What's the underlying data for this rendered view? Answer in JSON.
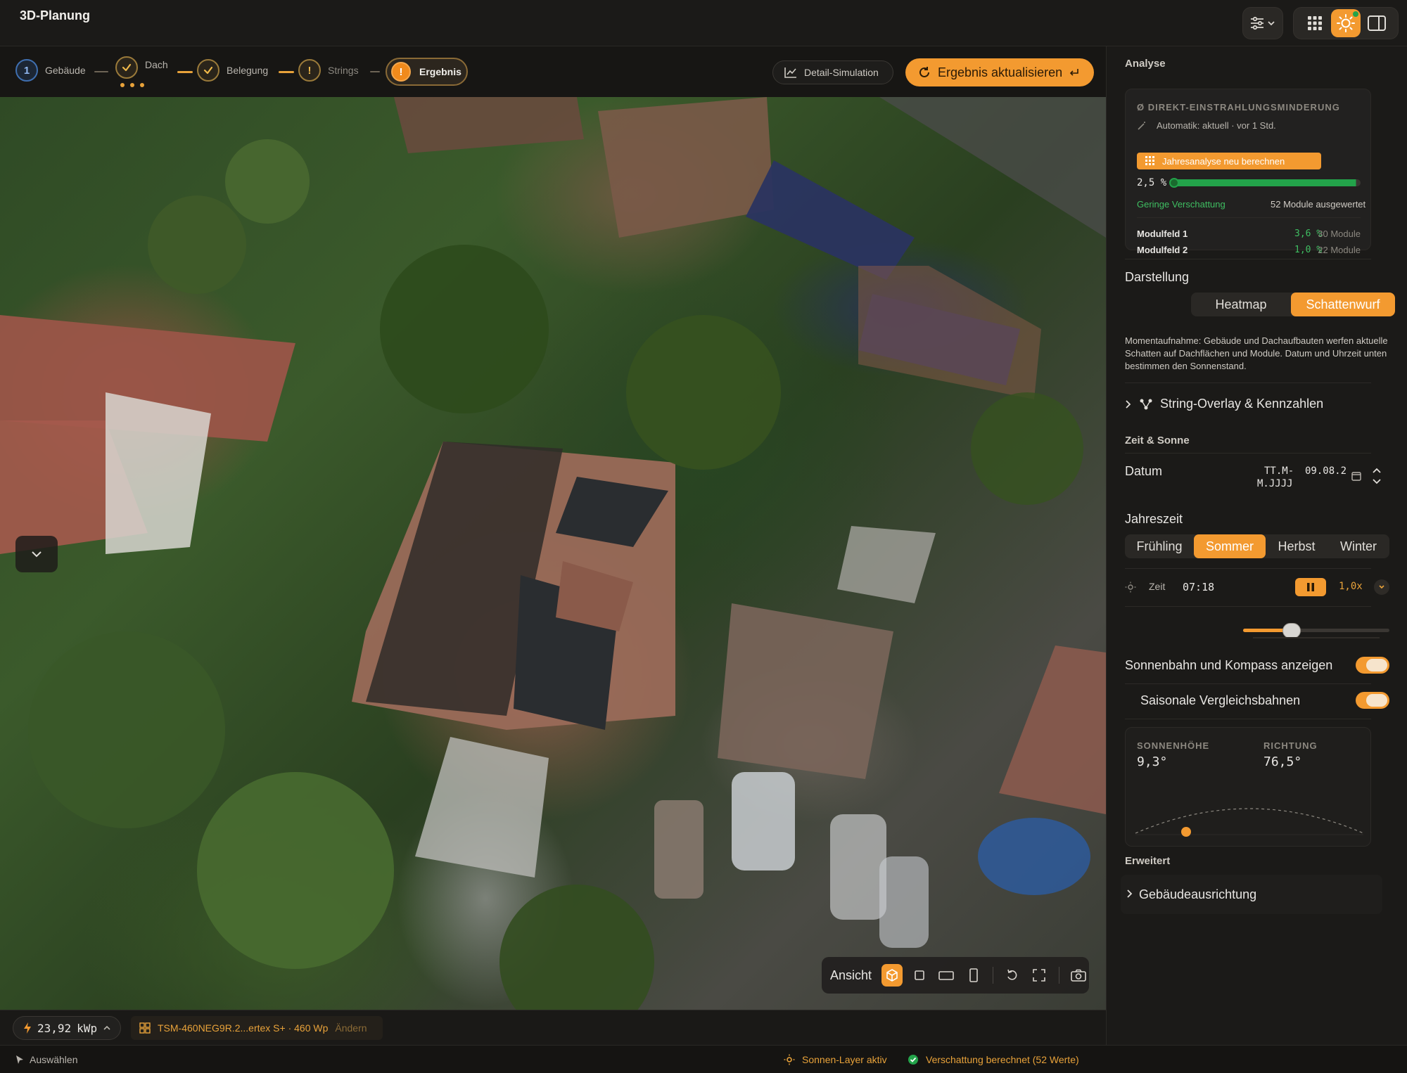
{
  "app": {
    "title": "3D-Planung"
  },
  "steps": [
    {
      "label": "Gebäude",
      "number": "1",
      "status": "done-number"
    },
    {
      "label": "Dach",
      "status": "check"
    },
    {
      "label": "Belegung",
      "status": "check"
    },
    {
      "label": "Strings",
      "status": "warning"
    },
    {
      "label": "Ergebnis",
      "status": "active-warning"
    }
  ],
  "step_icons": {
    "warning": "!",
    "check": "check-icon"
  },
  "actions": {
    "detail_sim": "Detail-Simulation",
    "update": "Ergebnis aktualisieren"
  },
  "view_toolbar": {
    "label": "Ansicht"
  },
  "bottom": {
    "kwp_value": "23,92",
    "kwp_unit": "kWp",
    "module_text": "TSM-460NEG9R.2...ertex S+ · 460 Wp",
    "module_change": "Ändern"
  },
  "status": {
    "select_tool": "Auswählen",
    "sun_layer": "Sonnen-Layer aktiv",
    "shade_calc": "Verschattung berechnet (52 Werte)"
  },
  "panel": {
    "analyse_title": "Analyse",
    "card": {
      "heading": "Ø DIREKT-EINSTRAHLUNGSMINDERUNG",
      "auto": "Automatik: aktuell · vor 1 Std.",
      "recalc": "Jahresanalyse neu berechnen",
      "value": "2,5 %",
      "progress_fraction": 0.975,
      "shading_label": "Geringe Verschattung",
      "modules_evaluated": "52 Module ausgewertet",
      "fields": [
        {
          "name": "Modulfeld 1",
          "pct": "3,6 %",
          "modules": "30 Module"
        },
        {
          "name": "Modulfeld 2",
          "pct": "1,0 %",
          "modules": "22 Module"
        }
      ]
    },
    "darstellung_title": "Darstellung",
    "darstellung_options": [
      "Heatmap",
      "Schattenwurf"
    ],
    "darstellung_selected": "Schattenwurf",
    "darstellung_desc": "Momentaufnahme: Gebäude und Dachaufbauten werfen aktuelle Schatten auf Dachflächen und Module. Datum und Uhrzeit unten bestimmen den Sonnenstand.",
    "string_overlay": "String-Overlay & Kennzahlen",
    "zeit_sonne_title": "Zeit & Sonne",
    "datum_label": "Datum",
    "datum_placeholder_1": "TT.M-",
    "datum_placeholder_2": "M.JJJJ",
    "datum_value": "09.08.2",
    "jahreszeit_label": "Jahreszeit",
    "seasons": [
      "Frühling",
      "Sommer",
      "Herbst",
      "Winter"
    ],
    "season_selected": "Sommer",
    "zeit_label": "Zeit",
    "zeit_value": "07:18",
    "speed": "1,0x",
    "time_slider_fraction": 0.33,
    "sunpath_label": "Sonnenbahn und Kompass anzeigen",
    "sunpath_on": true,
    "seasonal_label": "Saisonale Vergleichsbahnen",
    "seasonal_on": true,
    "sonnenhoehe_label": "SONNENHÖHE",
    "sonnenhoehe_value": "9,3°",
    "richtung_label": "RICHTUNG",
    "richtung_value": "76,5°",
    "erweitert_title": "Erweitert",
    "gebaeudeausrichtung": "Gebäudeausrichtung"
  },
  "colors": {
    "accent": "#f39a30",
    "success": "#23a34a",
    "step_blue": "#3f6fb0"
  }
}
